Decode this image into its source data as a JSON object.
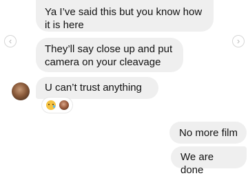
{
  "messages": [
    {
      "id": "in-1",
      "direction": "incoming",
      "text": "Ya I’ve said this but you know how\nit is here"
    },
    {
      "id": "in-2",
      "direction": "incoming",
      "text": "They’ll say close up and put\ncamera on your cleavage"
    },
    {
      "id": "in-3",
      "direction": "incoming",
      "text": "U can’t trust anything",
      "reactions": [
        "crying-face-emoji",
        "reactor-avatar"
      ]
    },
    {
      "id": "out-1",
      "direction": "outgoing",
      "text": "No more film"
    },
    {
      "id": "out-2",
      "direction": "outgoing",
      "text": "We are done"
    }
  ],
  "nav": {
    "prev_icon": "‹",
    "next_icon": "›"
  },
  "colors": {
    "bubble": "#efefef",
    "text": "#111111",
    "background": "#ffffff"
  }
}
